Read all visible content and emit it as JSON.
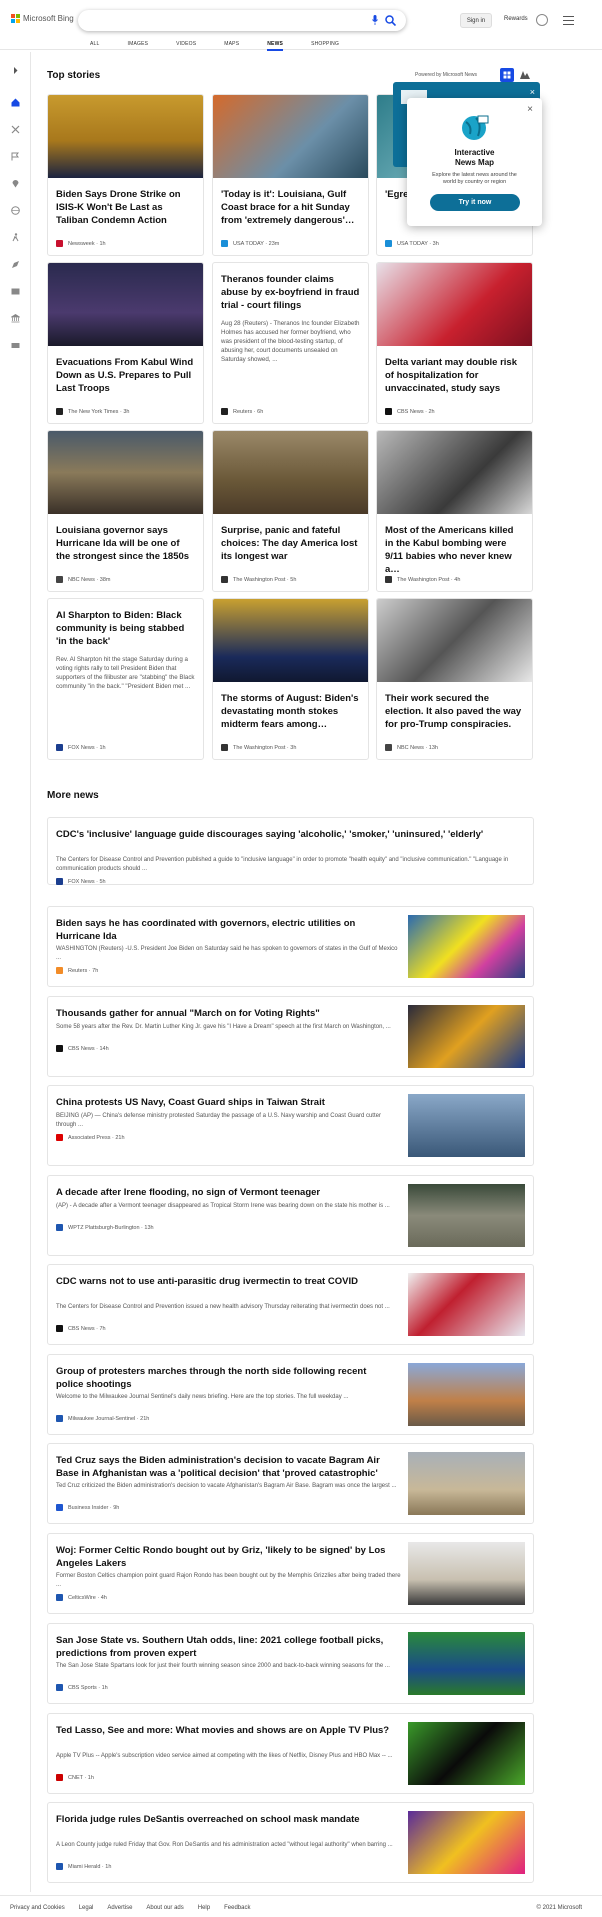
{
  "header": {
    "brand": "Microsoft Bing",
    "signin": "Sign in",
    "rewards": "Rewards",
    "tabs": [
      "ALL",
      "IMAGES",
      "VIDEOS",
      "MAPS",
      "NEWS",
      "SHOPPING"
    ],
    "active_tab": "NEWS"
  },
  "top_stories": {
    "heading": "Top stories",
    "powered": "Powered by Microsoft News",
    "cards": [
      {
        "title": "Biden Says Drone Strike on ISIS-K Won't Be Last as Taliban Condemn Action",
        "desc": "",
        "source": "Newsweek · 1h",
        "color": "#c8102e"
      },
      {
        "title": "'Today is it': Louisiana, Gulf Coast brace for a hit Sunday from 'extremely dangerous'…",
        "desc": "",
        "source": "USA TODAY · 23m",
        "color": "#1a8fd8"
      },
      {
        "title": "'Egre inevi wron",
        "desc": "",
        "source": "USA TODAY · 3h",
        "color": "#1a8fd8"
      },
      {
        "title": "Evacuations From Kabul Wind Down as U.S. Prepares to Pull Last Troops",
        "desc": "",
        "source": "The New York Times · 3h",
        "color": "#222"
      },
      {
        "title": "Theranos founder claims abuse by ex-boyfriend in fraud trial - court filings",
        "desc": "Aug 28 (Reuters) - Theranos Inc founder Elizabeth Holmes has accused her former boyfriend, who was president of the blood-testing startup, of abusing her, court documents unsealed on Saturday showed, ...",
        "source": "Reuters · 6h",
        "color": "#222"
      },
      {
        "title": "Delta variant may double risk of hospitalization for unvaccinated, study says",
        "desc": "",
        "source": "CBS News · 2h",
        "color": "#111"
      },
      {
        "title": "Louisiana governor says Hurricane Ida will be one of the strongest since the 1850s",
        "desc": "",
        "source": "NBC News · 38m",
        "color": "#444"
      },
      {
        "title": "Surprise, panic and fateful choices: The day America lost its longest war",
        "desc": "",
        "source": "The Washington Post · 5h",
        "color": "#333"
      },
      {
        "title": "Most of the Americans killed in the Kabul bombing were 9/11 babies who never knew a…",
        "desc": "",
        "source": "The Washington Post · 4h",
        "color": "#333"
      },
      {
        "title": "Al Sharpton to Biden: Black community is being stabbed 'in the back'",
        "desc": "Rev. Al Sharpton hit the stage Saturday during a voting rights rally to tell President Biden that supporters of the filibuster are \"stabbing\" the Black community \"in the back.\" \"President Biden met ...",
        "source": "FOX News · 1h",
        "color": "#1b3e8f"
      },
      {
        "title": "The storms of August: Biden's devastating month stokes midterm fears among…",
        "desc": "",
        "source": "The Washington Post · 3h",
        "color": "#333"
      },
      {
        "title": "Their work secured the election. It also paved the way for pro-Trump conspiracies.",
        "desc": "",
        "source": "NBC News · 13h",
        "color": "#444"
      }
    ]
  },
  "popup": {
    "title": "Interactive News Map",
    "desc": "Explore the latest news around the world by country or region",
    "button": "Try it now",
    "behind_button": "ow"
  },
  "more_news": {
    "heading": "More news",
    "items": [
      {
        "title": "CDC's 'inclusive' language guide discourages saying 'alcoholic,' 'smoker,' 'uninsured,' 'elderly'",
        "desc": "The Centers for Disease Control and Prevention published a guide to \"inclusive language\" in order to promote \"health equity\" and \"inclusive communication.\" \"Language in communication products should ...",
        "source": "FOX News · 5h",
        "color": "#1b3e8f"
      },
      {
        "title": "Biden says he has coordinated with governors, electric utilities on Hurricane Ida",
        "desc": "WASHINGTON (Reuters) -U.S. President Joe Biden on Saturday said he has spoken to governors of states in the Gulf of Mexico ...",
        "source": "Reuters · 7h",
        "color": "#f28c28"
      },
      {
        "title": "Thousands gather for annual \"March on for Voting Rights\"",
        "desc": "Some 58 years after the Rev. Dr. Martin Luther King Jr. gave his \"I Have a Dream\" speech at the first March on Washington, ...",
        "source": "CBS News · 14h",
        "color": "#111"
      },
      {
        "title": "China protests US Navy, Coast Guard ships in Taiwan Strait",
        "desc": "BEIJING (AP) — China's defense ministry protested Saturday the passage of a U.S. Navy warship and Coast Guard cutter through ...",
        "source": "Associated Press · 21h",
        "color": "#d00"
      },
      {
        "title": "A decade after Irene flooding, no sign of Vermont teenager",
        "desc": "(AP) - A decade after a Vermont teenager disappeared as Tropical Storm Irene was bearing down on the state his mother is ...",
        "source": "WPTZ Plattsburgh-Burlington · 13h",
        "color": "#1e56b0"
      },
      {
        "title": "CDC warns not to use anti-parasitic drug ivermectin to treat COVID",
        "desc": "The Centers for Disease Control and Prevention issued a new health advisory Thursday reiterating that ivermectin does not ...",
        "source": "CBS News · 7h",
        "color": "#111"
      },
      {
        "title": "Group of protesters marches through the north side following recent police shootings",
        "desc": "Welcome to the Milwaukee Journal Sentinel's daily news briefing. Here are the top stories. The full weekday ...",
        "source": "Milwaukee Journal-Sentinel · 21h",
        "color": "#1e56b0"
      },
      {
        "title": "Ted Cruz says the Biden administration's decision to vacate Bagram Air Base in Afghanistan was a 'political decision' that 'proved catastrophic'",
        "desc": "Ted Cruz criticized the Biden administration's decision to vacate Afghanistan's Bagram Air Base. Bagram was once the largest ...",
        "source": "Business Insider · 9h",
        "color": "#1e56d0"
      },
      {
        "title": "Woj: Former Celtic Rondo bought out by Griz, 'likely to be signed' by Los Angeles Lakers",
        "desc": "Former Boston Celtics champion point guard Rajon Rondo has been bought out by the Memphis Grizzlies after being traded there ...",
        "source": "CelticsWire · 4h",
        "color": "#1e56b0"
      },
      {
        "title": "San Jose State vs. Southern Utah odds, line: 2021 college football picks, predictions from proven expert",
        "desc": "The San Jose State Spartans look for just their fourth winning season since 2000 and back-to-back winning seasons for the ...",
        "source": "CBS Sports · 1h",
        "color": "#1e56b0"
      },
      {
        "title": "Ted Lasso, See and more: What movies and shows are on Apple TV Plus?",
        "desc": "Apple TV Plus -- Apple's subscription video service aimed at competing with the likes of Netflix, Disney Plus and HBO Max -- ...",
        "source": "CNET · 1h",
        "color": "#c00"
      },
      {
        "title": "Florida judge rules DeSantis overreached on school mask mandate",
        "desc": "A Leon County judge ruled Friday that Gov. Ron DeSantis and his administration acted \"without legal authority\" when barring ...",
        "source": "Miami Herald · 1h",
        "color": "#1e56b0"
      }
    ]
  },
  "footer": {
    "links": [
      "Privacy and Cookies",
      "Legal",
      "Advertise",
      "About our ads",
      "Help",
      "Feedback"
    ],
    "copyright": "© 2021 Microsoft"
  }
}
